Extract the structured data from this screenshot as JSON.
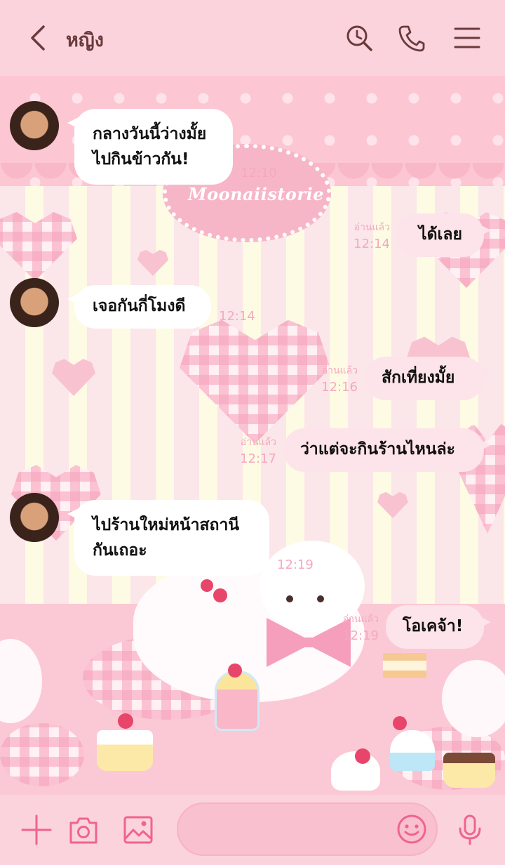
{
  "header": {
    "title": "หญิง",
    "icons": [
      "back-icon",
      "history-search-icon",
      "phone-icon",
      "menu-icon"
    ]
  },
  "wallpaper": {
    "logo_text": "Moonaiistorie"
  },
  "messages": [
    {
      "side": "in",
      "text": "กลางวันนี้ว่างมั้ย\nไปกินข้าวกัน!",
      "time": "12:10"
    },
    {
      "side": "out",
      "text": "ได้เลย",
      "read": "อ่านแล้ว",
      "time": "12:14"
    },
    {
      "side": "in",
      "text": "เจอกันกี่โมงดี",
      "time": "12:14"
    },
    {
      "side": "out",
      "text": "สักเที่ยงมั้ย",
      "read": "อ่านแล้ว",
      "time": "12:16"
    },
    {
      "side": "out",
      "text": "ว่าแต่จะกินร้านไหนล่ะ",
      "read": "อ่านแล้ว",
      "time": "12:17"
    },
    {
      "side": "in",
      "text": "ไปร้านใหม่หน้าสถานี\nกันเถอะ",
      "time": "12:19"
    },
    {
      "side": "out",
      "text": "โอเคจ้า!",
      "read": "อ่านแล้ว",
      "time": "12:19"
    }
  ],
  "composer": {
    "icons": [
      "plus-icon",
      "camera-icon",
      "image-icon",
      "emoji-icon",
      "microphone-icon"
    ],
    "input_value": ""
  },
  "colors": {
    "accent": "#f0648c",
    "header_text": "#6b3b3b",
    "meta": "#f4a9bf",
    "bubble_out": "#fde3ea"
  }
}
